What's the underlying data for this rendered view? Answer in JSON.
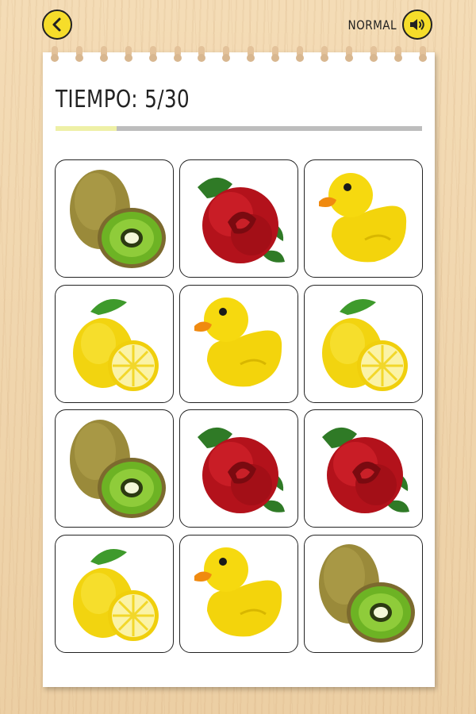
{
  "header": {
    "back_icon": "chevron-left-icon",
    "difficulty": "NORMAL",
    "sound_icon": "speaker-icon"
  },
  "timer": {
    "label": "TIEMPO: 5/30",
    "elapsed": 5,
    "total": 30
  },
  "colors": {
    "button_yellow": "#f6dd2a",
    "progress_fill": "#eef0a6",
    "progress_track": "#bdbdbd"
  },
  "board": {
    "rows": 4,
    "cols": 3,
    "cards": [
      "kiwi",
      "rose",
      "duck",
      "lemon",
      "duck",
      "lemon",
      "kiwi",
      "rose",
      "rose",
      "lemon",
      "duck",
      "kiwi"
    ]
  }
}
